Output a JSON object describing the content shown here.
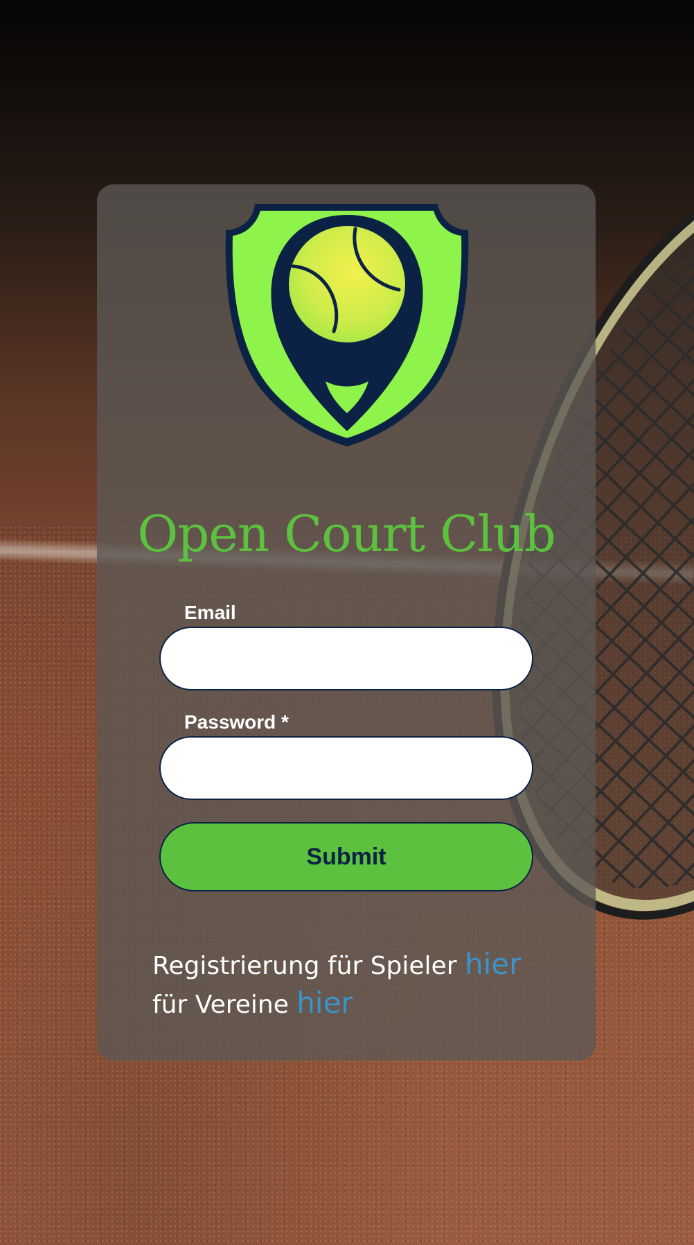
{
  "app": {
    "title": "Open Court Club"
  },
  "form": {
    "email_label": "Email",
    "email_value": "",
    "password_label": "Password *",
    "password_value": "",
    "submit_label": "Submit"
  },
  "registration": {
    "players_text": "Registrierung für Spieler",
    "players_link": "hier",
    "clubs_text": "für Vereine",
    "clubs_link": "hier"
  },
  "colors": {
    "brand_green": "#5cc13e",
    "logo_green": "#8ef44c",
    "navy": "#0b2244",
    "link_blue": "#3a94c9",
    "ball_yellow": "#e8f04a"
  },
  "icons": {
    "logo": "shield-location-pin-tennis-ball"
  }
}
